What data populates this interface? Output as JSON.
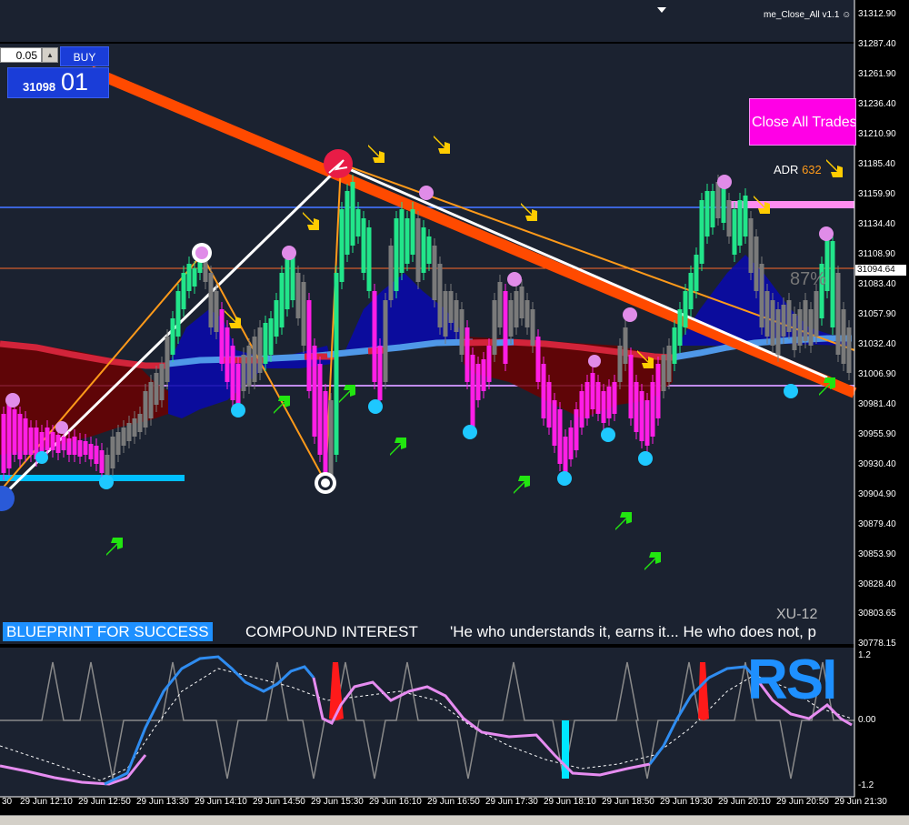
{
  "panel": {
    "lot": "0.05",
    "buy_label": "BUY",
    "price_small": "31098",
    "price_big": "01"
  },
  "ea_name": "me_Close_All v1.1",
  "smiley": "☺",
  "close_all_label": "Close All Trades",
  "adr": {
    "label": "ADR",
    "value": "632"
  },
  "pips_text": "87%",
  "symbol": "XU-12",
  "ticker": {
    "blueprint": "BLUEPRINT FOR SUCCESS",
    "compound": "COMPOUND INTEREST",
    "quote": "'He who understands it, earns it... He who does not, p"
  },
  "rsi_title": "RSI",
  "price_axis": [
    "31312.90",
    "31287.40",
    "31261.90",
    "31236.40",
    "31210.90",
    "31185.40",
    "31159.90",
    "31134.40",
    "31108.90",
    "31083.40",
    "31057.90",
    "31032.40",
    "31006.90",
    "30981.40",
    "30955.90",
    "30930.40",
    "30904.90",
    "30879.40",
    "30853.90",
    "30828.40",
    "30803.65",
    "30778.15"
  ],
  "current_price": "31094.64",
  "rsi_axis": [
    "1.2",
    "0.00",
    "-1.2"
  ],
  "time_axis": [
    "29 Jun 12:10",
    "29 Jun 12:50",
    "29 Jun 13:30",
    "29 Jun 14:10",
    "29 Jun 14:50",
    "29 Jun 15:30",
    "29 Jun 16:10",
    "29 Jun 16:50",
    "29 Jun 17:30",
    "29 Jun 18:10",
    "29 Jun 18:50",
    "29 Jun 19:30",
    "29 Jun 20:10",
    "29 Jun 20:50",
    "29 Jun 21:30"
  ],
  "time_axis_first": "30",
  "colors": {
    "background": "#1b2230",
    "bull": "#22e58a",
    "bear": "#ff1ee6",
    "neutral": "#7a7a7a",
    "trendline": "#ff4a00",
    "arrow_up": "#22e510",
    "arrow_down": "#ffcc00",
    "rsi_line": "#2f8cf0",
    "rsi_signal": "#e68cf0"
  },
  "icons": [
    "buy-arrow-icon",
    "sell-arrow-icon",
    "swing-high-dot-icon",
    "swing-low-dot-icon",
    "smiley-icon",
    "spin-up-icon"
  ]
}
